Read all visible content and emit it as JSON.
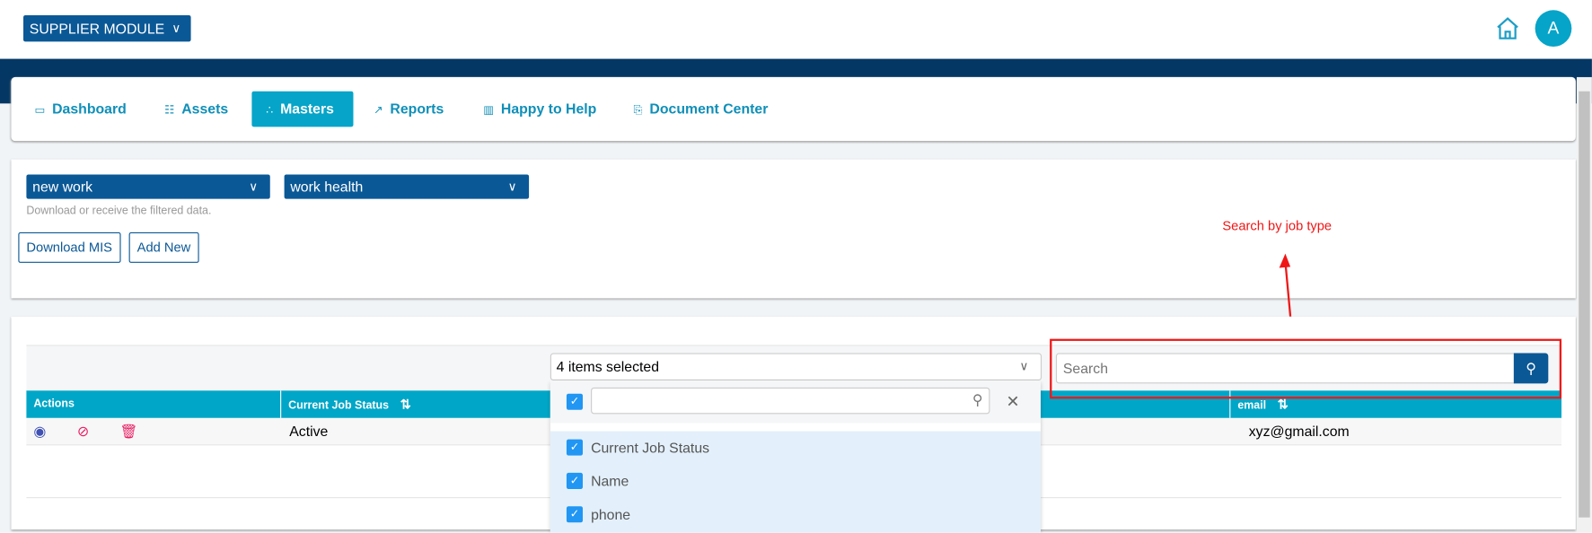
{
  "header": {
    "module_label": "SUPPLIER MODULE",
    "avatar_initial": "A"
  },
  "nav": {
    "tabs": [
      {
        "label": "Dashboard",
        "icon": "monitor-icon"
      },
      {
        "label": "Assets",
        "icon": "grid-icon"
      },
      {
        "label": "Masters",
        "icon": "sitemap-icon",
        "active": true
      },
      {
        "label": "Reports",
        "icon": "chart-icon"
      },
      {
        "label": "Happy to Help",
        "icon": "map-icon"
      },
      {
        "label": "Document Center",
        "icon": "documents-icon"
      }
    ]
  },
  "filters": {
    "select1": "new work",
    "select2": "work health",
    "hint": "Download or receive the filtered data.",
    "download_label": "Download MIS",
    "add_label": "Add New"
  },
  "annotation": {
    "text": "Search by job type",
    "color": "#f01616"
  },
  "table": {
    "columns_select": "4 items selected",
    "column_options": [
      {
        "label": "Current Job Status",
        "checked": true
      },
      {
        "label": "Name",
        "checked": true
      },
      {
        "label": "phone",
        "checked": true
      }
    ],
    "search_placeholder": "Search",
    "headers": {
      "actions": "Actions",
      "status": "Current Job Status",
      "email": "email"
    },
    "rows": [
      {
        "status": "Active",
        "email": "xyz@gmail.com"
      }
    ]
  },
  "colors": {
    "primary": "#0b5896",
    "accent": "#00a6c7",
    "band": "#053764"
  }
}
